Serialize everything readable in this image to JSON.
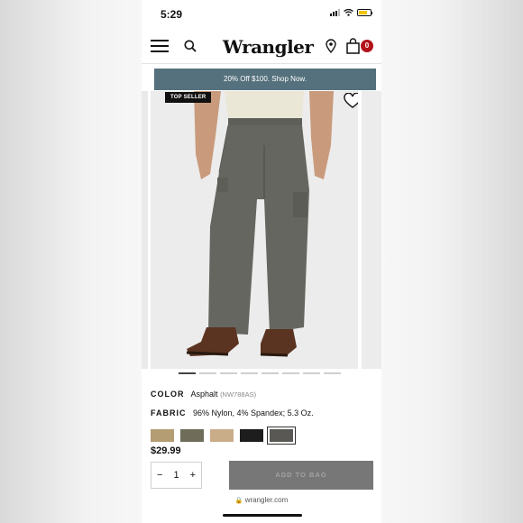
{
  "status_bar": {
    "time": "5:29"
  },
  "header": {
    "logo": "Wrangler",
    "bag_count": "0"
  },
  "promo": {
    "text": "20% Off $100. Shop Now."
  },
  "gallery": {
    "badge": "TOP SELLER",
    "slide_count": 8,
    "active_slide": 1
  },
  "product": {
    "color_label": "COLOR",
    "color_value": "Asphalt",
    "color_code": "(NW788AS)",
    "fabric_label": "FABRIC",
    "fabric_value": "96% Nylon, 4% Spandex; 5.3 Oz.",
    "swatches": [
      {
        "color": "#b49c73"
      },
      {
        "color": "#6f6d5a"
      },
      {
        "color": "#c9ad89"
      },
      {
        "color": "#1d1d1d"
      },
      {
        "color": "#5a5854",
        "selected": true
      }
    ],
    "price": "$29.99"
  },
  "cart": {
    "minus": "−",
    "quantity": "1",
    "plus": "+",
    "add_label": "ADD TO BAG"
  },
  "browser": {
    "url": "wrangler.com"
  },
  "colors": {
    "promo_bg": "#55717d",
    "bag_badge": "#b3121a",
    "button_bg": "#777777"
  }
}
